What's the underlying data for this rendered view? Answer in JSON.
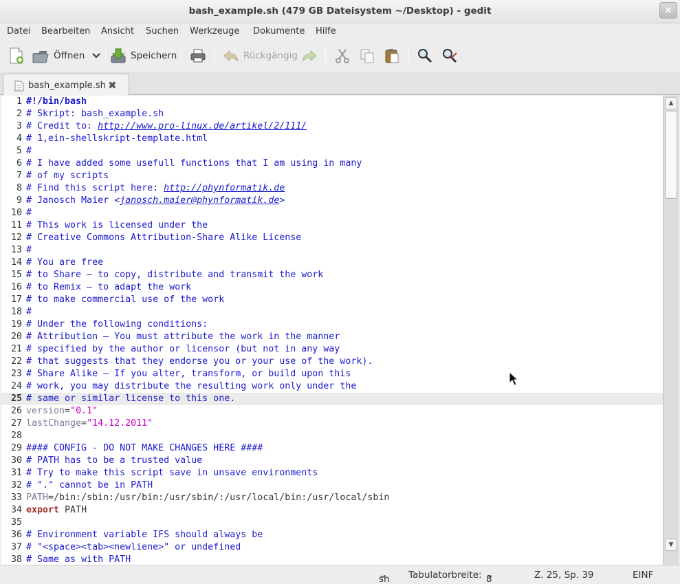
{
  "window": {
    "title": "bash_example.sh (479 GB Dateisystem ~/Desktop) - gedit",
    "close_glyph": "×"
  },
  "menubar": {
    "items": [
      "Datei",
      "Bearbeiten",
      "Ansicht",
      "Suchen",
      "Werkzeuge",
      "Dokumente",
      "Hilfe"
    ]
  },
  "toolbar": {
    "new_icon": "new-document-icon",
    "open_label": "Öffnen",
    "save_label": "Speichern",
    "undo_label": "Rückgängig"
  },
  "tab": {
    "label": "bash_example.sh",
    "close_glyph": "✖"
  },
  "editor": {
    "current_line": 25,
    "lines": [
      {
        "n": "1",
        "t": "#!/bin/bash"
      },
      {
        "n": "2",
        "t": "# Skript: bash_example.sh"
      },
      {
        "n": "3",
        "t": "# Credit to: ",
        "url": "http://www.pro-linux.de/artikel/2/111/"
      },
      {
        "n": "4",
        "t": "# 1,ein-shellskript-template.html"
      },
      {
        "n": "5",
        "t": "#"
      },
      {
        "n": "6",
        "t": "# I have added some usefull functions that I am using in many"
      },
      {
        "n": "7",
        "t": "# of my scripts"
      },
      {
        "n": "8",
        "t": "# Find this script here: ",
        "url": "http://phynformatik.de"
      },
      {
        "n": "9",
        "t": "# Janosch Maier <",
        "url": "janosch.maier@phynformatik.de",
        "tail": ">"
      },
      {
        "n": "10",
        "t": "#"
      },
      {
        "n": "11",
        "t": "# This work is licensed under the"
      },
      {
        "n": "12",
        "t": "# Creative Commons Attribution-Share Alike License"
      },
      {
        "n": "13",
        "t": "#"
      },
      {
        "n": "14",
        "t": "# You are free"
      },
      {
        "n": "15",
        "t": "# to Share — to copy, distribute and transmit the work"
      },
      {
        "n": "16",
        "t": "# to Remix — to adapt the work"
      },
      {
        "n": "17",
        "t": "# to make commercial use of the work"
      },
      {
        "n": "18",
        "t": "#"
      },
      {
        "n": "19",
        "t": "# Under the following conditions:"
      },
      {
        "n": "20",
        "t": "# Attribution — You must attribute the work in the manner"
      },
      {
        "n": "21",
        "t": "# specified by the author or licensor (but not in any way"
      },
      {
        "n": "22",
        "t": "# that suggests that they endorse you or your use of the work)."
      },
      {
        "n": "23",
        "t": "# Share Alike — If you alter, transform, or build upon this"
      },
      {
        "n": "24",
        "t": "# work, you may distribute the resulting work only under the"
      },
      {
        "n": "25",
        "t": "# same or similar license to this one."
      },
      {
        "n": "26",
        "var": "version",
        "str": "\"0.1\""
      },
      {
        "n": "27",
        "var": "lastChange",
        "str": "\"14.12.2011\""
      },
      {
        "n": "28",
        "t": ""
      },
      {
        "n": "29",
        "t": "#### CONFIG - DO NOT MAKE CHANGES HERE ####"
      },
      {
        "n": "30",
        "t": "# PATH has to be a trusted value"
      },
      {
        "n": "31",
        "t": "# Try to make this script save in unsave environments"
      },
      {
        "n": "32",
        "t": "# \".\" cannot be in PATH"
      },
      {
        "n": "33",
        "var": "PATH",
        "path": "/bin:/sbin:/usr/bin:/usr/sbin/:/usr/local/bin:/usr/local/sbin"
      },
      {
        "n": "34",
        "kw": "export",
        "rest": " PATH"
      },
      {
        "n": "35",
        "t": ""
      },
      {
        "n": "36",
        "t": "# Environment variable IFS should always be"
      },
      {
        "n": "37",
        "t": "# \"<space><tab><newliene>\" or undefined"
      },
      {
        "n": "38",
        "t": "# Same as with PATH"
      }
    ]
  },
  "statusbar": {
    "language": "sh",
    "tab_width_label": "Tabulatorbreite:",
    "tab_width_value": "8",
    "position": "Z. 25, Sp. 39",
    "mode": "EINF"
  }
}
